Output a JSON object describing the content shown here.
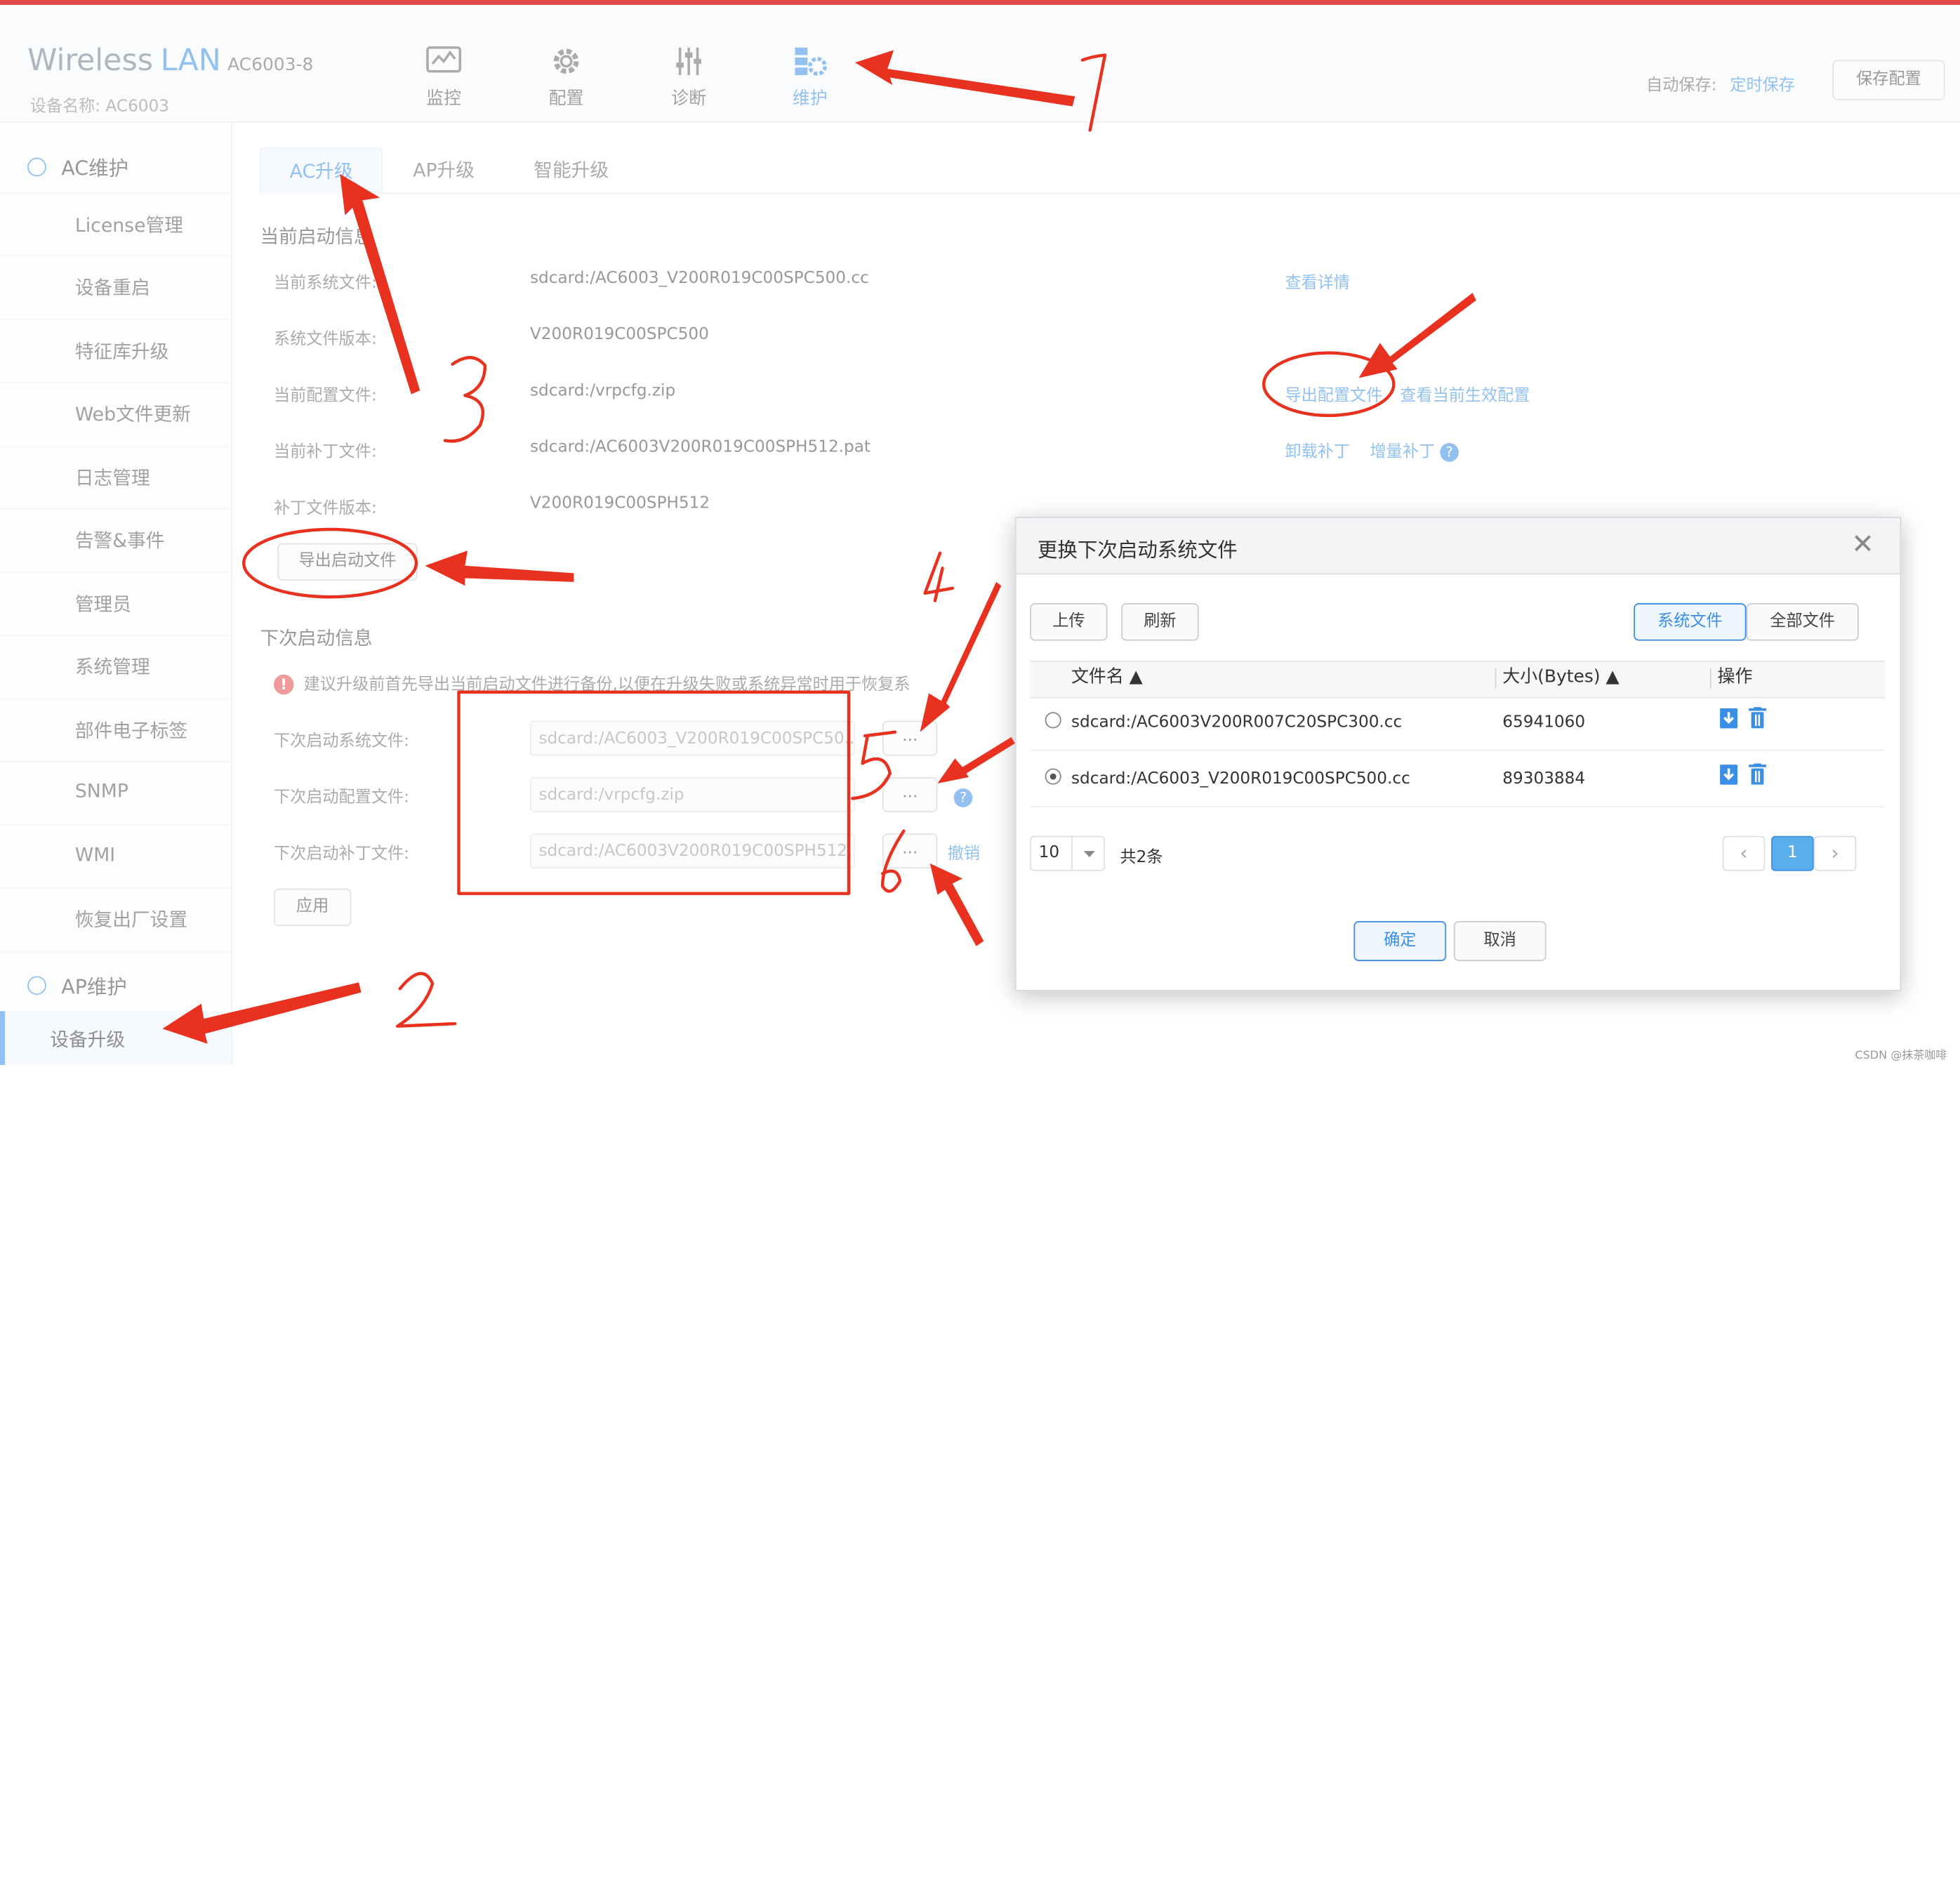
{
  "header": {
    "brand_wireless": "Wireless",
    "brand_lan": "LAN",
    "model": "AC6003-8",
    "device_name": "设备名称:  AC6003",
    "nav": [
      {
        "label": "监控",
        "icon": "monitor-icon"
      },
      {
        "label": "配置",
        "icon": "gear-icon"
      },
      {
        "label": "诊断",
        "icon": "sliders-icon"
      },
      {
        "label": "维护",
        "icon": "maintenance-icon"
      }
    ],
    "active_nav": "维护",
    "autosave_label": "自动保存:",
    "autosave_value": "定时保存",
    "save_config": "保存配置"
  },
  "sidebar": {
    "group_ac": "AC维护",
    "items": [
      "License管理",
      "设备重启",
      "特征库升级",
      "Web文件更新",
      "日志管理",
      "告警&事件",
      "管理员",
      "系统管理",
      "部件电子标签",
      "SNMP",
      "WMI",
      "恢复出厂设置"
    ],
    "group_ap": "AP维护",
    "active_item": "设备升级"
  },
  "tabs": [
    "AC升级",
    "AP升级",
    "智能升级"
  ],
  "current": {
    "title": "当前启动信息",
    "rows": [
      {
        "label": "当前系统文件:",
        "value": "sdcard:/AC6003_V200R019C00SPC500.cc"
      },
      {
        "label": "系统文件版本:",
        "value": "V200R019C00SPC500"
      },
      {
        "label": "当前配置文件:",
        "value": "sdcard:/vrpcfg.zip"
      },
      {
        "label": "当前补丁文件:",
        "value": "sdcard:/AC6003V200R019C00SPH512.pat"
      },
      {
        "label": "补丁文件版本:",
        "value": "V200R019C00SPH512"
      }
    ],
    "link_details": "查看详情",
    "link_export_config": "导出配置文件",
    "link_view_effective": "查看当前生效配置",
    "link_unload_patch": "卸载补丁",
    "link_incremental_patch": "增量补丁",
    "export_startup_btn": "导出启动文件"
  },
  "next": {
    "title": "下次启动信息",
    "warning": "建议升级前首先导出当前启动文件进行备份,以便在升级失败或系统异常时用于恢复系",
    "rows": [
      {
        "label": "下次启动系统文件:",
        "value": "sdcard:/AC6003_V200R019C00SPC50..."
      },
      {
        "label": "下次启动配置文件:",
        "value": "sdcard:/vrpcfg.zip"
      },
      {
        "label": "下次启动补丁文件:",
        "value": "sdcard:/AC6003V200R019C00SPH512..."
      }
    ],
    "browse": "...",
    "revoke": "撤销",
    "apply": "应用"
  },
  "dialog": {
    "title": "更换下次启动系统文件",
    "close": "✕",
    "upload": "上传",
    "refresh": "刷新",
    "seg_system": "系统文件",
    "seg_all": "全部文件",
    "col_name": "文件名 ▲",
    "col_size": "大小(Bytes) ▲",
    "col_action": "操作",
    "files": [
      {
        "name": "sdcard:/AC6003V200R007C20SPC300.cc",
        "size": "65941060",
        "selected": false
      },
      {
        "name": "sdcard:/AC6003_V200R019C00SPC500.cc",
        "size": "89303884",
        "selected": true
      }
    ],
    "page_size": "10",
    "total": "共2条",
    "current_page": "1",
    "prev": "‹",
    "next": "›",
    "ok": "确定",
    "cancel": "取消"
  },
  "annotations": [
    "1",
    "2",
    "3",
    "4",
    "5",
    "6"
  ],
  "watermark": "CSDN @抹茶咖啡",
  "colors": {
    "accent": "#3a8ee6",
    "ink": "#e8321f"
  }
}
